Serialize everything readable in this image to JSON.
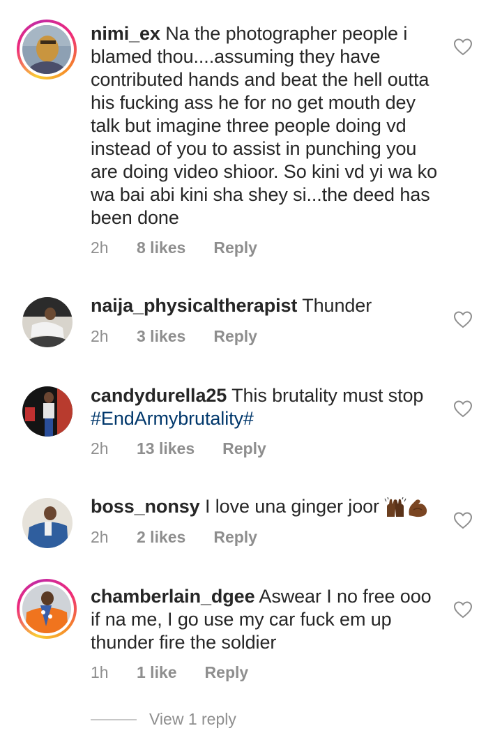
{
  "comments": [
    {
      "username": "nimi_ex",
      "text": " Na the photographer people i blamed thou....assuming they have contributed hands and beat the hell outta his fucking ass he for no get mouth dey talk but imagine three people doing vd instead of you to assist in punching you are doing video shioor. So kini vd yi wa ko wa bai abi kini sha shey si...the deed has been done",
      "time": "2h",
      "likes": "8 likes",
      "reply": "Reply"
    },
    {
      "username": "naija_physicaltherapist",
      "text": " Thunder",
      "time": "2h",
      "likes": "3 likes",
      "reply": "Reply"
    },
    {
      "username": "candydurella25",
      "text": " This brutality must stop ",
      "hashtag": "#EndArmybrutality#",
      "time": "2h",
      "likes": "13 likes",
      "reply": "Reply"
    },
    {
      "username": "boss_nonsy",
      "text": " I love una ginger joor ",
      "emoji": [
        "raising-hands-emoji",
        "flexed-biceps-emoji"
      ],
      "time": "2h",
      "likes": "2 likes",
      "reply": "Reply"
    },
    {
      "username": "chamberlain_dgee",
      "text": " Aswear I no free ooo if na me, I go use my car fuck em up thunder fire the soldier",
      "time": "1h",
      "likes": "1 like",
      "reply": "Reply"
    }
  ],
  "view_replies": "View 1 reply",
  "colors": {
    "text": "#262626",
    "secondary": "#8e8e8e",
    "hashtag": "#00376b",
    "story_ring": "#ee2a7b"
  },
  "icons": {
    "like": "heart-outline-icon"
  }
}
